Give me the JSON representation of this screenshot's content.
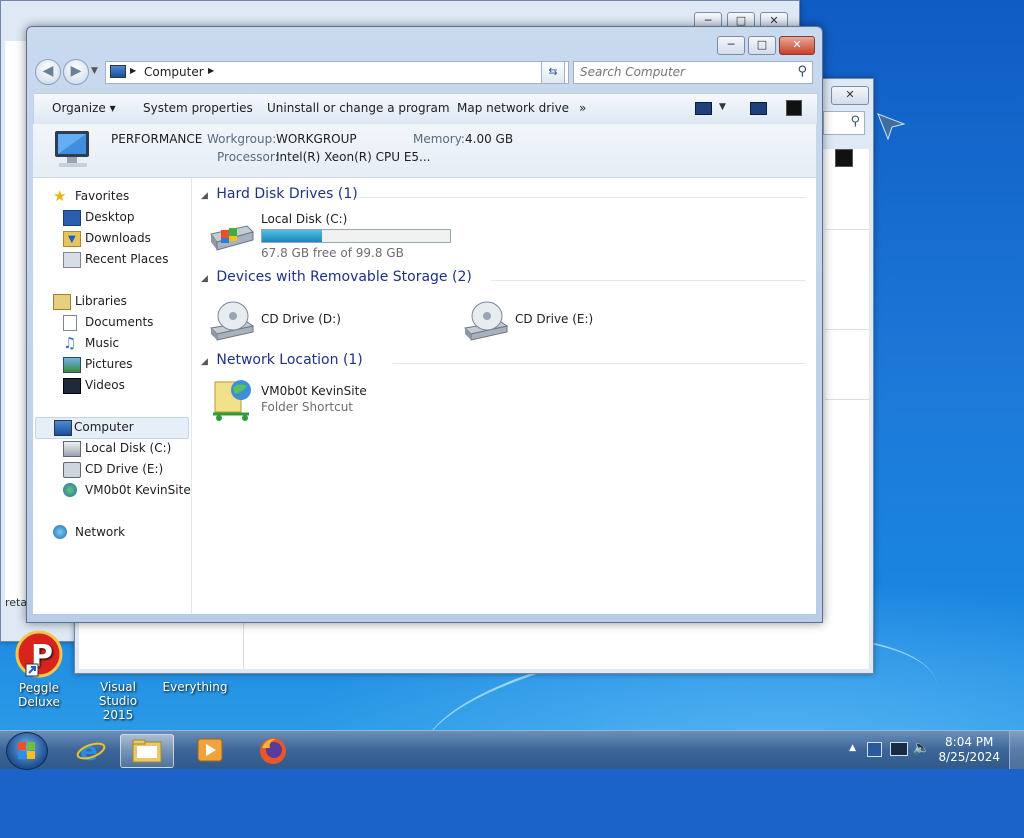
{
  "window": {
    "address_path": "Computer",
    "search_placeholder": "Search Computer",
    "caption": {
      "minimize": "─",
      "maximize": "□",
      "close": "✕"
    }
  },
  "toolbar": {
    "organize": "Organize ▾",
    "system_properties": "System properties",
    "uninstall": "Uninstall or change a program",
    "map_drive": "Map network drive",
    "more": "»"
  },
  "details": {
    "computer_name": "PERFORMANCE",
    "workgroup_label": "Workgroup:",
    "workgroup": "WORKGROUP",
    "memory_label": "Memory:",
    "memory": "4.00 GB",
    "processor_label": "Processor:",
    "processor": "Intel(R) Xeon(R) CPU E5..."
  },
  "nav": {
    "favorites": "Favorites",
    "desktop": "Desktop",
    "downloads": "Downloads",
    "recent": "Recent Places",
    "libraries": "Libraries",
    "documents": "Documents",
    "music": "Music",
    "pictures": "Pictures",
    "videos": "Videos",
    "computer": "Computer",
    "local_disk": "Local Disk (C:)",
    "cd_drive": "CD Drive (E:)",
    "net_share": "VM0b0t KevinSite",
    "network": "Network"
  },
  "groups": {
    "hdd": "Hard Disk Drives (1)",
    "removable": "Devices with Removable Storage (2)",
    "network": "Network Location (1)"
  },
  "drives": {
    "c_name": "Local Disk (C:)",
    "c_free": "67.8 GB free of 99.8 GB",
    "c_used_fraction": 0.32,
    "d_name": "CD Drive (D:)",
    "e_name": "CD Drive (E:)",
    "net_name": "VM0b0t KevinSite",
    "net_sub": "Folder Shortcut"
  },
  "desktop_icons": {
    "peggle": "Peggle Deluxe",
    "vs_line1": "Visual Studio",
    "vs_line2": "2015",
    "everything": "Everything",
    "partial": "reta"
  },
  "clock": {
    "time": "8:04 PM",
    "date": "8/25/2024"
  },
  "colors": {
    "accent": "#1e3287",
    "progress": "#2aa3d8"
  }
}
